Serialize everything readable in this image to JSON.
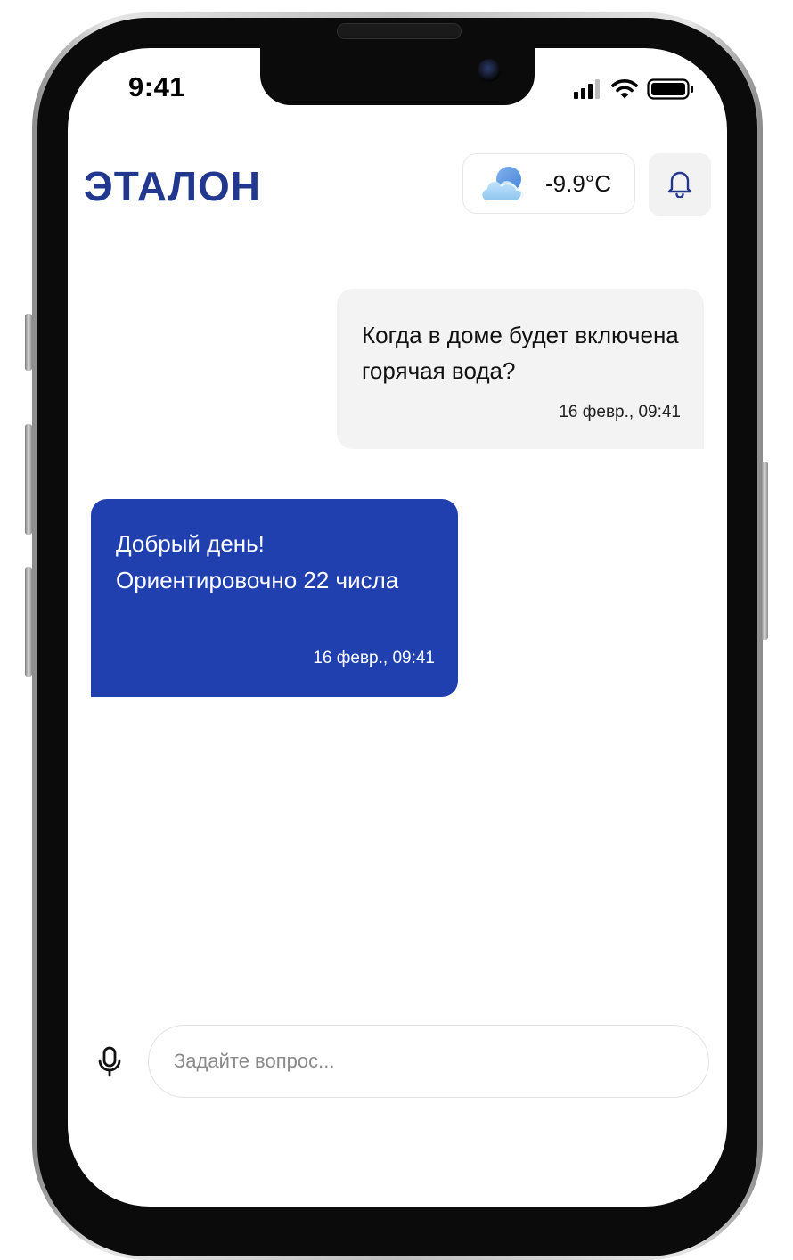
{
  "status_bar": {
    "time": "9:41",
    "icons": [
      "signal-icon",
      "wifi-icon",
      "battery-icon"
    ]
  },
  "header": {
    "brand": "ЭТАЛОН",
    "weather": {
      "icon": "partly-cloudy-icon",
      "temperature": "-9.9°C"
    },
    "notifications_icon": "bell-icon"
  },
  "chat": {
    "messages": [
      {
        "direction": "outgoing",
        "text": "Когда в доме будет включена горячая вода?",
        "time": "16 февр., 09:41"
      },
      {
        "direction": "incoming",
        "text": "Добрый день! Ориентировочно 22 числа",
        "time": "16 февр., 09:41"
      }
    ]
  },
  "composer": {
    "mic_icon": "microphone-icon",
    "placeholder": "Задайте вопрос...",
    "value": ""
  },
  "colors": {
    "brand": "#22378e",
    "incoming_bubble": "#2040b0",
    "outgoing_bubble": "#f3f3f3"
  }
}
